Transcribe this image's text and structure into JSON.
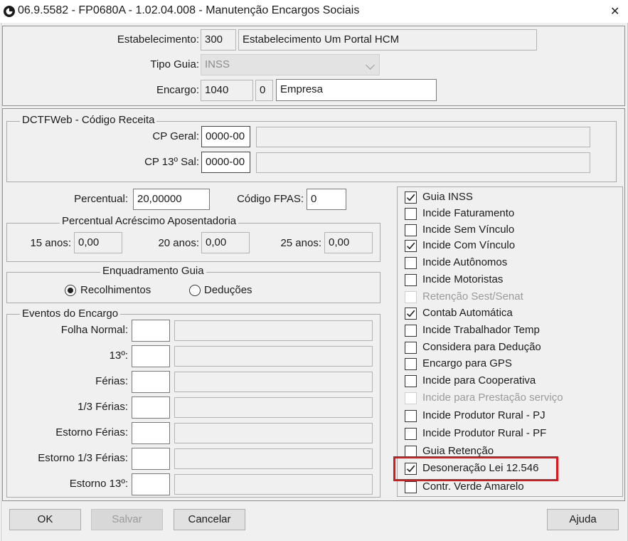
{
  "window": {
    "title": "06.9.5582 - FP0680A - 1.02.04.008 - Manutenção Encargos Sociais",
    "close_glyph": "✕"
  },
  "header": {
    "estabelecimento": {
      "label": "Estabelecimento:",
      "code": "300",
      "name": "Estabelecimento Um Portal HCM"
    },
    "tipo_guia": {
      "label": "Tipo Guia:",
      "value": "INSS"
    },
    "encargo": {
      "label": "Encargo:",
      "code": "1040",
      "seq": "0",
      "name": "Empresa"
    }
  },
  "dctfweb": {
    "title": "DCTFWeb - Código Receita",
    "cp_geral": {
      "label": "CP Geral:",
      "value": "0000-00",
      "desc": ""
    },
    "cp_13": {
      "label": "CP 13º Sal:",
      "value": "0000-00",
      "desc": ""
    }
  },
  "percentual": {
    "label": "Percentual:",
    "value": "20,00000"
  },
  "codigo_fpas": {
    "label": "Código FPAS:",
    "value": "0"
  },
  "acrescimo": {
    "title": "Percentual Acréscimo Aposentadoria",
    "anos15": {
      "label": "15 anos:",
      "value": "0,00"
    },
    "anos20": {
      "label": "20 anos:",
      "value": "0,00"
    },
    "anos25": {
      "label": "25 anos:",
      "value": "0,00"
    }
  },
  "enquadramento": {
    "title": "Enquadramento Guia",
    "options": [
      {
        "label": "Recolhimentos",
        "selected": true
      },
      {
        "label": "Deduções",
        "selected": false
      }
    ]
  },
  "eventos": {
    "title": "Eventos do Encargo",
    "rows": [
      {
        "label": "Folha Normal:",
        "code": "",
        "desc": ""
      },
      {
        "label": "13º:",
        "code": "",
        "desc": ""
      },
      {
        "label": "Férias:",
        "code": "",
        "desc": ""
      },
      {
        "label": "1/3 Férias:",
        "code": "",
        "desc": ""
      },
      {
        "label": "Estorno Férias:",
        "code": "",
        "desc": ""
      },
      {
        "label": "Estorno 1/3 Férias:",
        "code": "",
        "desc": ""
      },
      {
        "label": "Estorno 13º:",
        "code": "",
        "desc": ""
      }
    ]
  },
  "flags": [
    {
      "label": "Guia INSS",
      "checked": true,
      "disabled": false
    },
    {
      "label": "Incide Faturamento",
      "checked": false,
      "disabled": false
    },
    {
      "label": "Incide Sem Vínculo",
      "checked": false,
      "disabled": false
    },
    {
      "label": "Incide Com Vínculo",
      "checked": true,
      "disabled": false
    },
    {
      "label": "Incide Autônomos",
      "checked": false,
      "disabled": false
    },
    {
      "label": "Incide Motoristas",
      "checked": false,
      "disabled": false
    },
    {
      "label": "Retenção Sest/Senat",
      "checked": false,
      "disabled": true
    },
    {
      "label": "Contab Automática",
      "checked": true,
      "disabled": false
    },
    {
      "label": "Incide Trabalhador Temp",
      "checked": false,
      "disabled": false
    },
    {
      "label": "Considera para Dedução",
      "checked": false,
      "disabled": false
    },
    {
      "label": "Encargo para GPS",
      "checked": false,
      "disabled": false
    },
    {
      "label": "Incide para Cooperativa",
      "checked": false,
      "disabled": false
    },
    {
      "label": "Incide para Prestação serviço",
      "checked": false,
      "disabled": true
    },
    {
      "label": "Incide Produtor Rural - PJ",
      "checked": false,
      "disabled": false
    },
    {
      "label": "Incide Produtor Rural - PF",
      "checked": false,
      "disabled": false
    },
    {
      "label": "Guia Retenção",
      "checked": false,
      "disabled": false
    },
    {
      "label": "Desoneração Lei 12.546",
      "checked": true,
      "disabled": false
    },
    {
      "label": "Contr. Verde Amarelo",
      "checked": false,
      "disabled": false
    }
  ],
  "buttons": {
    "ok": "OK",
    "salvar": "Salvar",
    "cancelar": "Cancelar",
    "ajuda": "Ajuda"
  },
  "colors": {
    "highlight": "#e3151a",
    "window_bg": "#f0f0f0"
  }
}
